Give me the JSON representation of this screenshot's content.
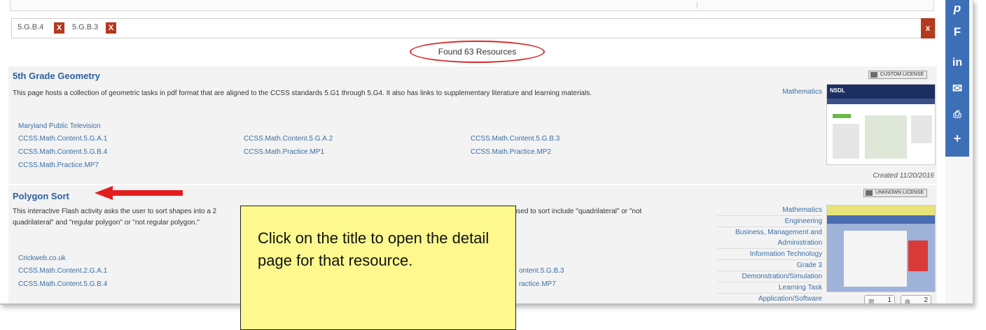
{
  "filters": {
    "chips": [
      {
        "label": "5.G.B.4",
        "remove": "X"
      },
      {
        "label": "5.G.B.3",
        "remove": "X"
      }
    ],
    "clear": "x"
  },
  "found_text": "Found 63 Resources",
  "results": [
    {
      "title": "5th Grade Geometry",
      "description": "This page hosts a collection of geometric tasks in pdf format that are aligned to the CCSS standards 5.G1 through 5.G4. It also has links to supplementary literature and learning materials.",
      "license": "CUSTOM LICENSE",
      "subject": "Mathematics",
      "publisher": "Maryland Public Television",
      "standards": [
        "CCSS.Math.Content.5.G.A.1",
        "CCSS.Math.Content.5.G.A.2",
        "CCSS.Math.Content.5.G.B.3",
        "CCSS.Math.Content.5.G.B.4",
        "CCSS.Math.Practice.MP1",
        "CCSS.Math.Practice.MP2",
        "CCSS.Math.Practice.MP7"
      ],
      "thumb_logo": "NSDL",
      "created": "Created 11/20/2016"
    },
    {
      "title": "Polygon Sort",
      "description_a": "This interactive Flash activity asks the user to sort shapes into a 2",
      "description_b": "s used to sort include \"quadrilateral\" or \"not",
      "description_c": "quadrilateral\" and \"regular polygon\" or \"not regular polygon.\"",
      "license": "UNKNOWN LICENSE",
      "subjects": [
        "Mathematics",
        "Engineering",
        "Business, Management and Administration",
        "Information Technology",
        "Grade 3",
        "Demonstration/Simulation",
        "Learning Task",
        "Application/Software"
      ],
      "publisher": "Crickweb.co.uk",
      "standards": [
        "CCSS.Math.Content.2.G.A.1",
        "ontent.5.G.B.3",
        "CCSS.Math.Content.5.G.B.4",
        "ractice.MP7"
      ],
      "counts": [
        "1",
        "2"
      ]
    }
  ],
  "social": [
    "p",
    "F",
    "in",
    "✉",
    "⎙",
    "+"
  ],
  "callout": "Click on the title to open the detail page for that resource.",
  "colors": {
    "accent_red": "#d62b2b",
    "link_blue": "#2b5f9e",
    "callout_bg": "#fdf98f",
    "social_bg": "#3d6fb6"
  }
}
